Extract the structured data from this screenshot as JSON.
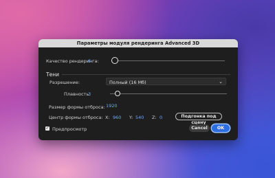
{
  "dialog": {
    "title": "Параметры модуля рендеринга Advanced 3D",
    "quality": {
      "label": "Качество рендеринга:",
      "value": "8"
    },
    "shadows": {
      "heading": "Тени",
      "resolution": {
        "label": "Разрешение:",
        "value": "Полный (16 Мб)"
      },
      "smoothness": {
        "label": "Плавность:",
        "value": "3"
      },
      "shadow_size": {
        "label": "Размер формы отброса:",
        "value": "1920"
      },
      "shadow_center": {
        "label": "Центр формы отброса:",
        "x_label": "X:",
        "x_value": "960",
        "y_label": "Y:",
        "y_value": "540",
        "z_label": "Z:",
        "z_value": "0"
      },
      "fit_button": "Подгонка под сцену"
    },
    "preview": {
      "label": "Предпросмотр",
      "checked": true
    },
    "cancel_button": "Cancel",
    "ok_button": "OK",
    "colors": {
      "accent": "#2d6fe0",
      "value_blue": "#6fa8ff"
    }
  }
}
